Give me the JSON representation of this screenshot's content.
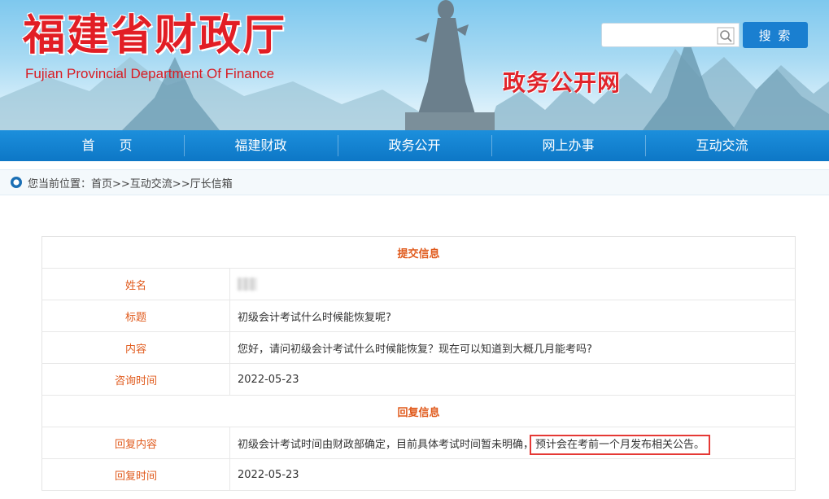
{
  "header": {
    "logo_cn": "福建省财政厅",
    "logo_en": "Fujian Provincial Department Of Finance",
    "portal_name": "政务公开网",
    "search": {
      "placeholder": "",
      "button_label": "搜 索"
    }
  },
  "nav": {
    "items": [
      "首页",
      "福建财政",
      "政务公开",
      "网上办事",
      "互动交流"
    ]
  },
  "breadcrumb": {
    "prefix": "您当前位置：",
    "path": "首页>>互动交流>>厅长信箱"
  },
  "submission": {
    "section_title": "提交信息",
    "name_label": "姓名",
    "title_label": "标题",
    "title_value": "初级会计考试什么时候能恢复呢?",
    "content_label": "内容",
    "content_value": "您好，请问初级会计考试什么时候能恢复？现在可以知道到大概几月能考吗?",
    "time_label": "咨询时间",
    "time_value": "2022-05-23"
  },
  "reply": {
    "section_title": "回复信息",
    "content_label": "回复内容",
    "content_part1": "初级会计考试时间由财政部确定，目前具体考试时间暂未明确，",
    "content_part2": "预计会在考前一个月发布相关公告。",
    "time_label": "回复时间",
    "time_value": "2022-05-23"
  },
  "colors": {
    "nav_blue": "#0d77c6",
    "label_orange": "#e05a1c",
    "brand_red": "#e21e25",
    "highlight_red": "#e53935"
  }
}
